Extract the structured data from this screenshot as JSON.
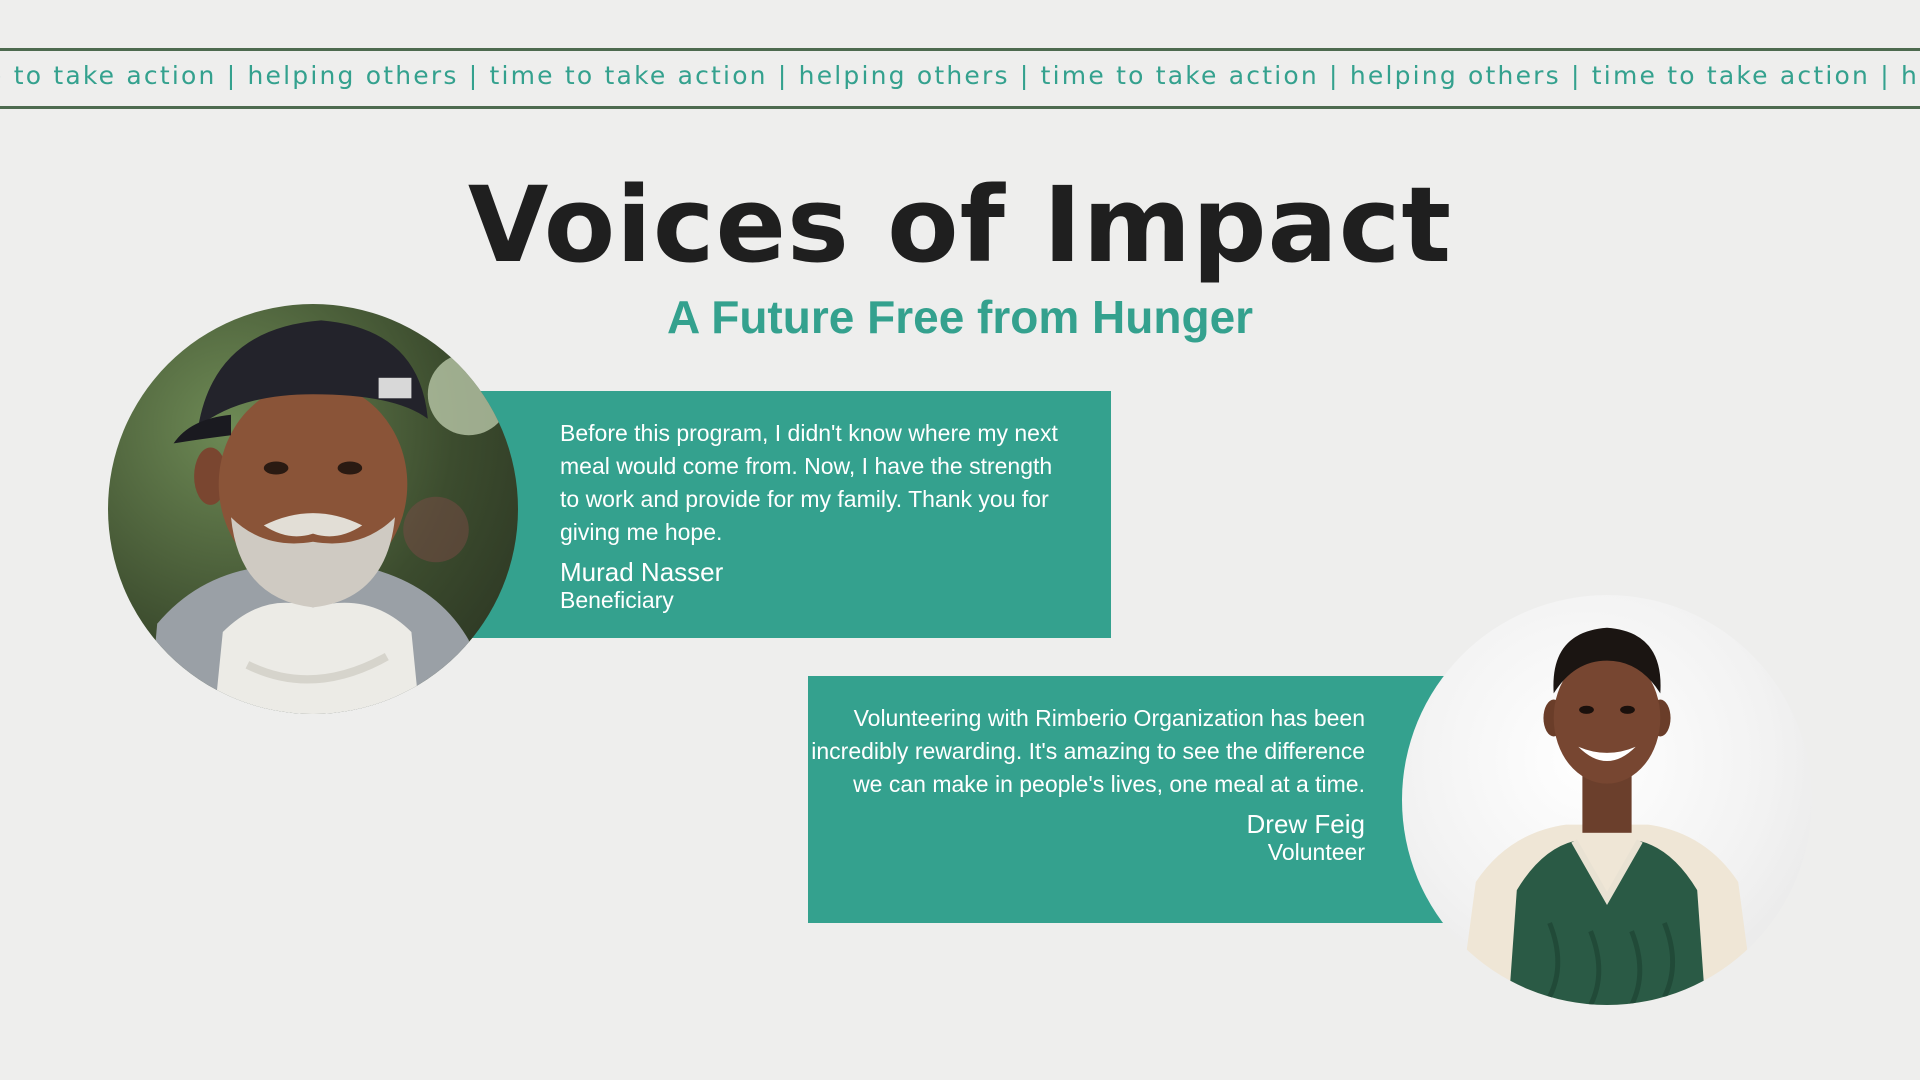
{
  "ticker": {
    "text": "e to take action | helping others | time to take action | helping others | time to take action | helping others | time to take action | helping others | time to take action | helping others"
  },
  "header": {
    "title": "Voices of Impact",
    "subtitle": "A Future Free from Hunger"
  },
  "testimonials": [
    {
      "quote": "Before this program, I didn't know where my next meal would come from. Now, I have the strength to work and provide for my family. Thank you for giving me hope.",
      "name": "Murad Nasser",
      "role": "Beneficiary",
      "photo_icon": "portrait-elderly-man-cap"
    },
    {
      "quote": "Volunteering with Rimberio Organization  has been incredibly rewarding. It's amazing to see the difference we can make in people's lives, one meal at a time.",
      "name": "Drew Feig",
      "role": "Volunteer",
      "photo_icon": "portrait-young-man-sweater-vest"
    }
  ],
  "colors": {
    "background": "#eeeeed",
    "accent": "#34a18e",
    "ticker_border": "#4d6a4f",
    "title": "#1f1f1f",
    "panel_text": "#ffffff"
  }
}
